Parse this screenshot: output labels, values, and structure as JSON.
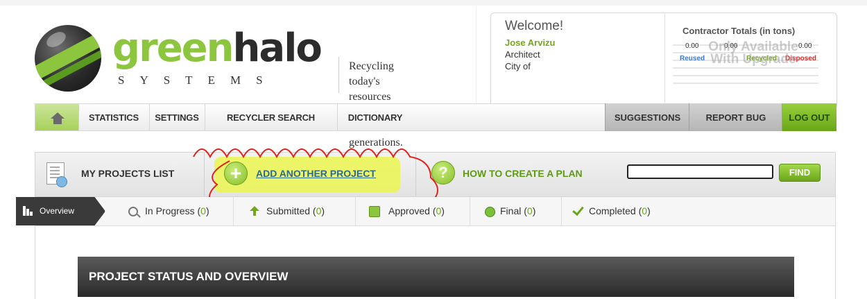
{
  "brand": {
    "name_green": "green",
    "name_dark": "halo",
    "sub": "SYSTEMS",
    "tagline_line1": "Recycling today's resources",
    "tagline_line2": "for tomorrow's generations."
  },
  "user": {
    "welcome": "Welcome!",
    "name": "Jose Arvizu",
    "role": "Architect",
    "city": "City of"
  },
  "contractor": {
    "title": "Contractor Totals (in tons)",
    "reused_value": "0.00",
    "recycled_value": "0.00",
    "disposed_value": "0.00",
    "reused_label": "Reused",
    "recycled_label": "Recycled",
    "disposed_label": "Disposed",
    "upgrade_line1": "Only Available",
    "upgrade_line2": "With Upgrade",
    "colors": {
      "reused": "#3a7bd5",
      "recycled": "#74a51b",
      "disposed": "#d22c2c"
    }
  },
  "nav": {
    "home_icon": "home-icon",
    "statistics": "STATISTICS",
    "settings": "SETTINGS",
    "recycler_search": "RECYCLER SEARCH",
    "dictionary": "DICTIONARY",
    "suggestions": "SUGGESTIONS",
    "report_bug": "REPORT BUG",
    "logout": "LOG OUT"
  },
  "projects": {
    "my_projects": "MY PROJECTS LIST",
    "add_project": "ADD ANOTHER PROJECT",
    "how_to": "HOW TO CREATE A PLAN",
    "search_value": "",
    "find": "FIND",
    "highlight_color": "#ebf550"
  },
  "tabs": {
    "overview": "Overview",
    "in_progress": "In Progress",
    "in_progress_count": "0",
    "submitted": "Submitted",
    "submitted_count": "0",
    "approved": "Approved",
    "approved_count": "0",
    "final": "Final",
    "final_count": "0",
    "completed": "Completed",
    "completed_count": "0"
  },
  "status": {
    "title": "PROJECT STATUS AND OVERVIEW"
  },
  "colors": {
    "brand_green": "#8cc63f",
    "accent_green": "#6aa618",
    "link_blue": "#2e6a8a"
  }
}
